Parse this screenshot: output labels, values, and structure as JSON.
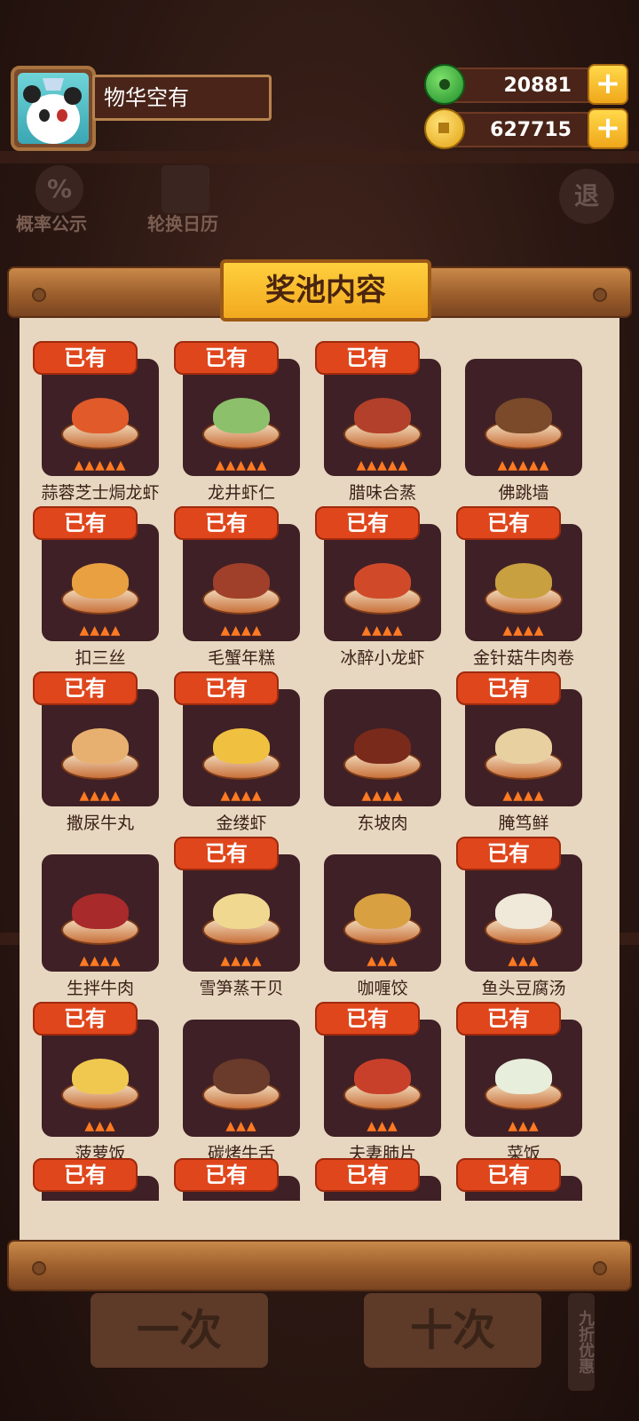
{
  "profile": {
    "name": "物华空有"
  },
  "currencies": {
    "jade": "20881",
    "coins": "627715",
    "add_label": "+"
  },
  "side_buttons": {
    "probability": "概率公示",
    "probability_icon": "%",
    "calendar": "轮换日历",
    "exit_icon": "退"
  },
  "panel": {
    "title": "奖池内容"
  },
  "owned_label": "已有",
  "items": [
    {
      "name": "蒜蓉芝士焗龙虾",
      "owned": true,
      "flames": 5,
      "color": "#e05a2a"
    },
    {
      "name": "龙井虾仁",
      "owned": true,
      "flames": 5,
      "color": "#8cc06a"
    },
    {
      "name": "腊味合蒸",
      "owned": true,
      "flames": 5,
      "color": "#b2402a"
    },
    {
      "name": "佛跳墙",
      "owned": false,
      "flames": 5,
      "color": "#7a4a2a"
    },
    {
      "name": "扣三丝",
      "owned": true,
      "flames": 4,
      "color": "#e8a040"
    },
    {
      "name": "毛蟹年糕",
      "owned": true,
      "flames": 4,
      "color": "#a0402a"
    },
    {
      "name": "冰醉小龙虾",
      "owned": true,
      "flames": 4,
      "color": "#d04a2a"
    },
    {
      "name": "金针菇牛肉卷",
      "owned": true,
      "flames": 4,
      "color": "#c8a040"
    },
    {
      "name": "撒尿牛丸",
      "owned": true,
      "flames": 4,
      "color": "#e8b070"
    },
    {
      "name": "金缕虾",
      "owned": true,
      "flames": 4,
      "color": "#f0c040"
    },
    {
      "name": "东坡肉",
      "owned": false,
      "flames": 4,
      "color": "#7a2a1a"
    },
    {
      "name": "腌笃鲜",
      "owned": true,
      "flames": 4,
      "color": "#e8d0a0"
    },
    {
      "name": "生拌牛肉",
      "owned": false,
      "flames": 4,
      "color": "#a82a2a"
    },
    {
      "name": "雪笋蒸干贝",
      "owned": true,
      "flames": 4,
      "color": "#f0d890"
    },
    {
      "name": "咖喱饺",
      "owned": false,
      "flames": 3,
      "color": "#d8a040"
    },
    {
      "name": "鱼头豆腐汤",
      "owned": true,
      "flames": 3,
      "color": "#f0e8d8"
    },
    {
      "name": "菠萝饭",
      "owned": true,
      "flames": 3,
      "color": "#f0c850"
    },
    {
      "name": "碳烤牛舌",
      "owned": false,
      "flames": 3,
      "color": "#6a3a2a"
    },
    {
      "name": "夫妻肺片",
      "owned": true,
      "flames": 3,
      "color": "#c8402a"
    },
    {
      "name": "菜饭",
      "owned": true,
      "flames": 3,
      "color": "#e8eedc"
    },
    {
      "name": "",
      "owned": true,
      "flames": 0,
      "color": "#3f2026"
    },
    {
      "name": "",
      "owned": true,
      "flames": 0,
      "color": "#3f2026"
    },
    {
      "name": "",
      "owned": true,
      "flames": 0,
      "color": "#3f2026"
    },
    {
      "name": "",
      "owned": true,
      "flames": 0,
      "color": "#3f2026"
    }
  ],
  "bottom": {
    "single": "一次",
    "ten": "十次",
    "discount": "九折优惠"
  }
}
